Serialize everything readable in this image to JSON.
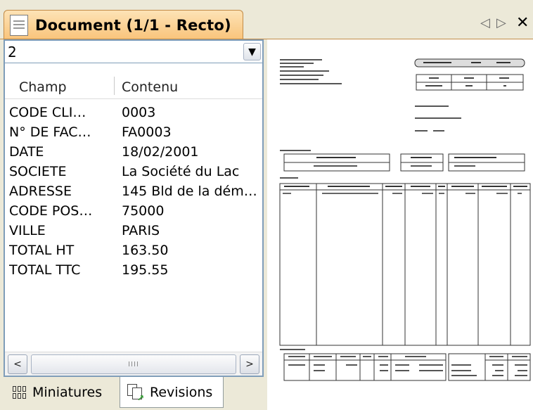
{
  "window": {
    "tab_title": "Document (1/1 - Recto)",
    "nav_prev": "◁",
    "nav_next": "▷",
    "close": "✕"
  },
  "selector": {
    "value": "2",
    "dropdown_icon": "chevron-down-icon"
  },
  "grid": {
    "headers": [
      "Champ",
      "Contenu"
    ],
    "rows": [
      {
        "field": "CODE CLI…",
        "value": "0003"
      },
      {
        "field": "N° DE FAC…",
        "value": "FA0003"
      },
      {
        "field": "DATE",
        "value": "18/02/2001"
      },
      {
        "field": "SOCIETE",
        "value": "La Société du Lac"
      },
      {
        "field": "ADRESSE",
        "value": "145 Bld de la dém…"
      },
      {
        "field": "CODE POS…",
        "value": "75000"
      },
      {
        "field": "VILLE",
        "value": "PARIS"
      },
      {
        "field": "TOTAL HT",
        "value": "163.50"
      },
      {
        "field": "TOTAL TTC",
        "value": "195.55"
      }
    ]
  },
  "scrollbar": {
    "left": "<",
    "right": ">",
    "thumb_grip": "IIII"
  },
  "bottom_tabs": {
    "miniatures": "Miniatures",
    "revisions": "Revisions"
  },
  "colors": {
    "tab_gradient_top": "#fde3b6",
    "tab_gradient_bottom": "#f9c47b",
    "panel_border": "#7f9db9",
    "background": "#ece9d8"
  }
}
